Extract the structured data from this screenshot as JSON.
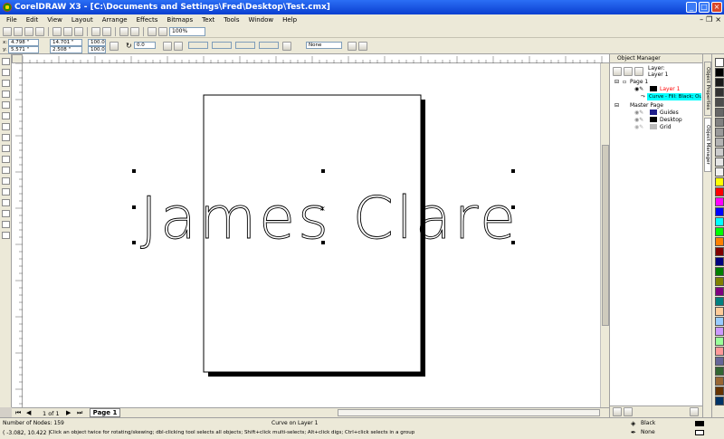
{
  "window": {
    "title": "CorelDRAW X3 - [C:\\Documents and Settings\\Fred\\Desktop\\Test.cmx]"
  },
  "menu": [
    "File",
    "Edit",
    "View",
    "Layout",
    "Arrange",
    "Effects",
    "Bitmaps",
    "Text",
    "Tools",
    "Window",
    "Help"
  ],
  "toolbar": {
    "zoom_value": "100%"
  },
  "propbar": {
    "x": "4.798 \"",
    "y": "5.571 \"",
    "width": "14.701 \"",
    "height": "2.508 \"",
    "scale_w": "100.0",
    "scale_h": "100.0",
    "angle": "0.0",
    "outline": "None"
  },
  "canvas": {
    "text": "James Clare"
  },
  "document_tabs": {
    "page_count": "1 of 1",
    "current_page": "Page 1"
  },
  "docker": {
    "title": "Object Manager",
    "page_label": "Page 1",
    "layer_label": "Layer 1",
    "header_label": "Layer:",
    "header_value": "Layer 1",
    "selected_object": "Curve - Fill: Black; Ou",
    "master_page": "Master Page",
    "layers": [
      "Guides",
      "Desktop",
      "Grid"
    ],
    "tabs": [
      "Object Properties",
      "Object Manager"
    ]
  },
  "status": {
    "nodes": "Number of Nodes: 159",
    "object_info": "Curve on Layer 1",
    "coords": "( -3.082, 10.422 )",
    "hint": "Click an object twice for rotating/skewing; dbl-clicking tool selects all objects; Shift+click multi-selects; Alt+click digs; Ctrl+click selects in a group",
    "fill": "Black",
    "outline": "None"
  },
  "colors": {
    "palette": [
      "#ffffff",
      "#000000",
      "#1a1a1a",
      "#333333",
      "#4d4d4d",
      "#666666",
      "#808080",
      "#999999",
      "#b3b3b3",
      "#cccccc",
      "#e6e6e6",
      "#f2f2f2",
      "#ffff00",
      "#ff0000",
      "#ff00ff",
      "#0000ff",
      "#00ffff",
      "#00ff00",
      "#ff8000",
      "#800000",
      "#000080",
      "#008000",
      "#808000",
      "#800080",
      "#008080",
      "#ffcc99",
      "#99ccff",
      "#cc99ff",
      "#99ff99",
      "#ff9999",
      "#666699",
      "#336633",
      "#996633",
      "#663300",
      "#003366"
    ],
    "selected_highlight": "#00ffff",
    "layer_red": "#ff0000"
  }
}
